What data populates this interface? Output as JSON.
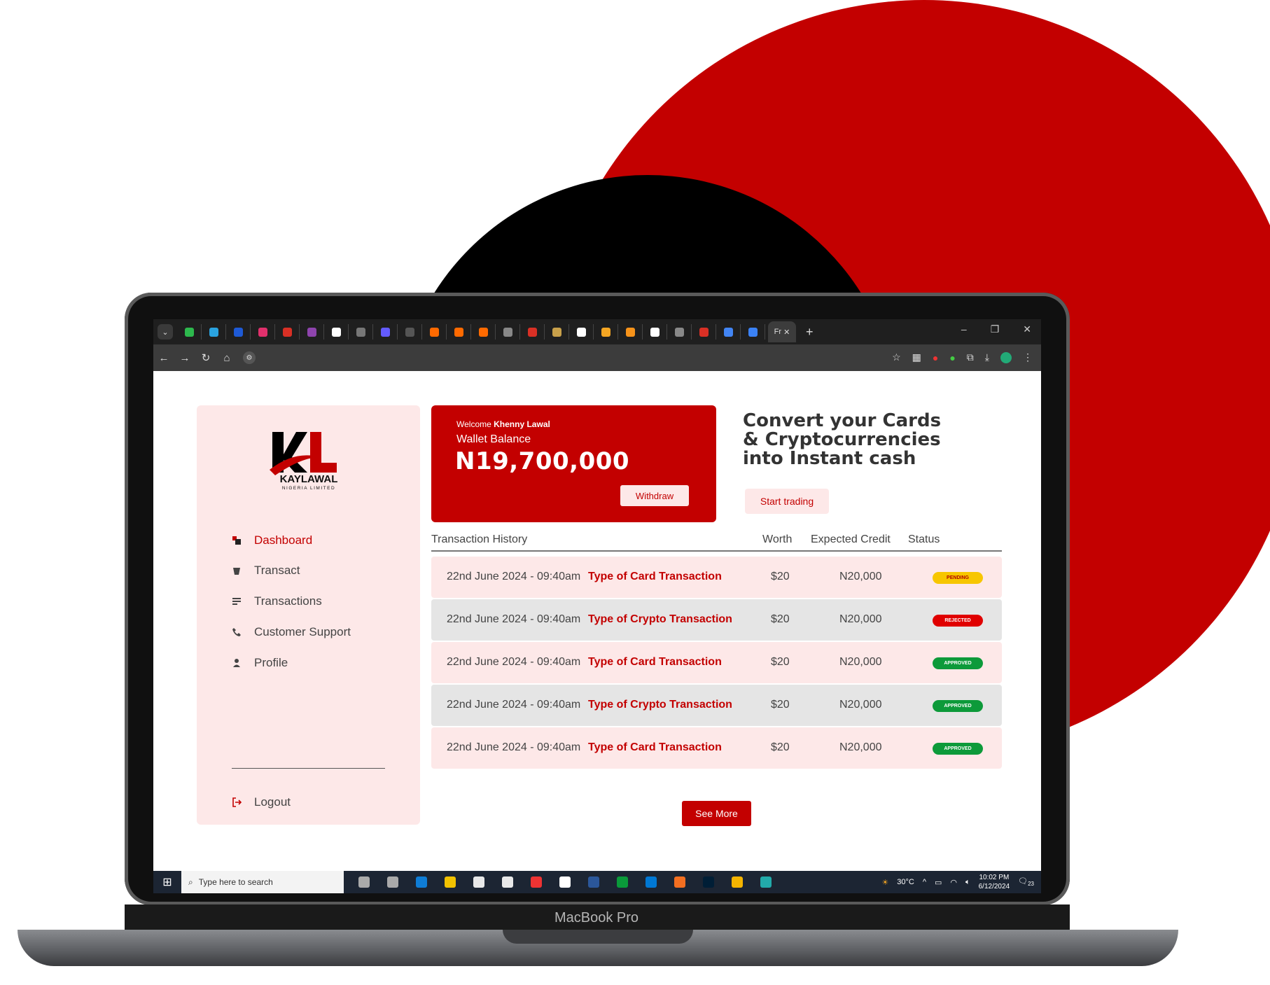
{
  "device_label": "MacBook Pro",
  "browser": {
    "active_tab_label": "Fr",
    "new_tab": "+",
    "window_controls": [
      "–",
      "❐",
      "✕"
    ],
    "favicon_colors": [
      "#2db84d",
      "#2aa3e0",
      "#1e5ad6",
      "#e1306c",
      "#d93025",
      "#8e44ad",
      "#ffffff",
      "#777777",
      "#635bff",
      "#555555",
      "#ff6a00",
      "#ff6a00",
      "#ff6a00",
      "#888888",
      "#d93025",
      "#c8a04a",
      "#ffffff",
      "#f5a623",
      "#f7931a",
      "#ffffff",
      "#888888",
      "#d93025",
      "#4285f4",
      "#3b82f6"
    ]
  },
  "sidebar": {
    "logo_text": "KAYLAWAL",
    "logo_subtext": "NIGERIA LIMITED",
    "items": [
      {
        "label": "Dashboard",
        "icon": "dashboard-icon"
      },
      {
        "label": "Transact",
        "icon": "cup-icon"
      },
      {
        "label": "Transactions",
        "icon": "list-icon"
      },
      {
        "label": "Customer Support",
        "icon": "phone-icon"
      },
      {
        "label": "Profile",
        "icon": "user-icon"
      }
    ],
    "logout_label": "Logout"
  },
  "wallet": {
    "welcome_prefix": "Welcome",
    "user_name": "Khenny Lawal",
    "balance_label": "Wallet Balance",
    "balance": "N19,700,000",
    "withdraw_label": "Withdraw"
  },
  "promo": {
    "headline": "Convert your Cards & Cryptocurrencies into Instant cash",
    "cta_label": "Start trading"
  },
  "transactions": {
    "headers": {
      "history": "Transaction History",
      "worth": "Worth",
      "credit": "Expected Credit",
      "status": "Status"
    },
    "rows": [
      {
        "date": "22nd June 2024 - 09:40am",
        "type": "Type of Card Transaction",
        "worth": "$20",
        "credit": "N20,000",
        "status": "PENDING"
      },
      {
        "date": "22nd June 2024 - 09:40am",
        "type": "Type of Crypto Transaction",
        "worth": "$20",
        "credit": "N20,000",
        "status": "REJECTED"
      },
      {
        "date": "22nd June 2024 - 09:40am",
        "type": "Type of Card Transaction",
        "worth": "$20",
        "credit": "N20,000",
        "status": "APPROVED"
      },
      {
        "date": "22nd June 2024 - 09:40am",
        "type": "Type of Crypto Transaction",
        "worth": "$20",
        "credit": "N20,000",
        "status": "APPROVED"
      },
      {
        "date": "22nd June 2024 - 09:40am",
        "type": "Type of Card Transaction",
        "worth": "$20",
        "credit": "N20,000",
        "status": "APPROVED"
      }
    ],
    "see_more_label": "See More"
  },
  "status_colors": {
    "PENDING": "#f7c600",
    "REJECTED": "#e00000",
    "APPROVED": "#0d9a3a"
  },
  "taskbar": {
    "search_placeholder": "Type here to search",
    "weather": "30°C",
    "time": "10:02 PM",
    "date": "6/12/2024",
    "notification_count": "23"
  },
  "colors": {
    "brand_red": "#c30000",
    "panel_pink": "#fde8e8"
  }
}
